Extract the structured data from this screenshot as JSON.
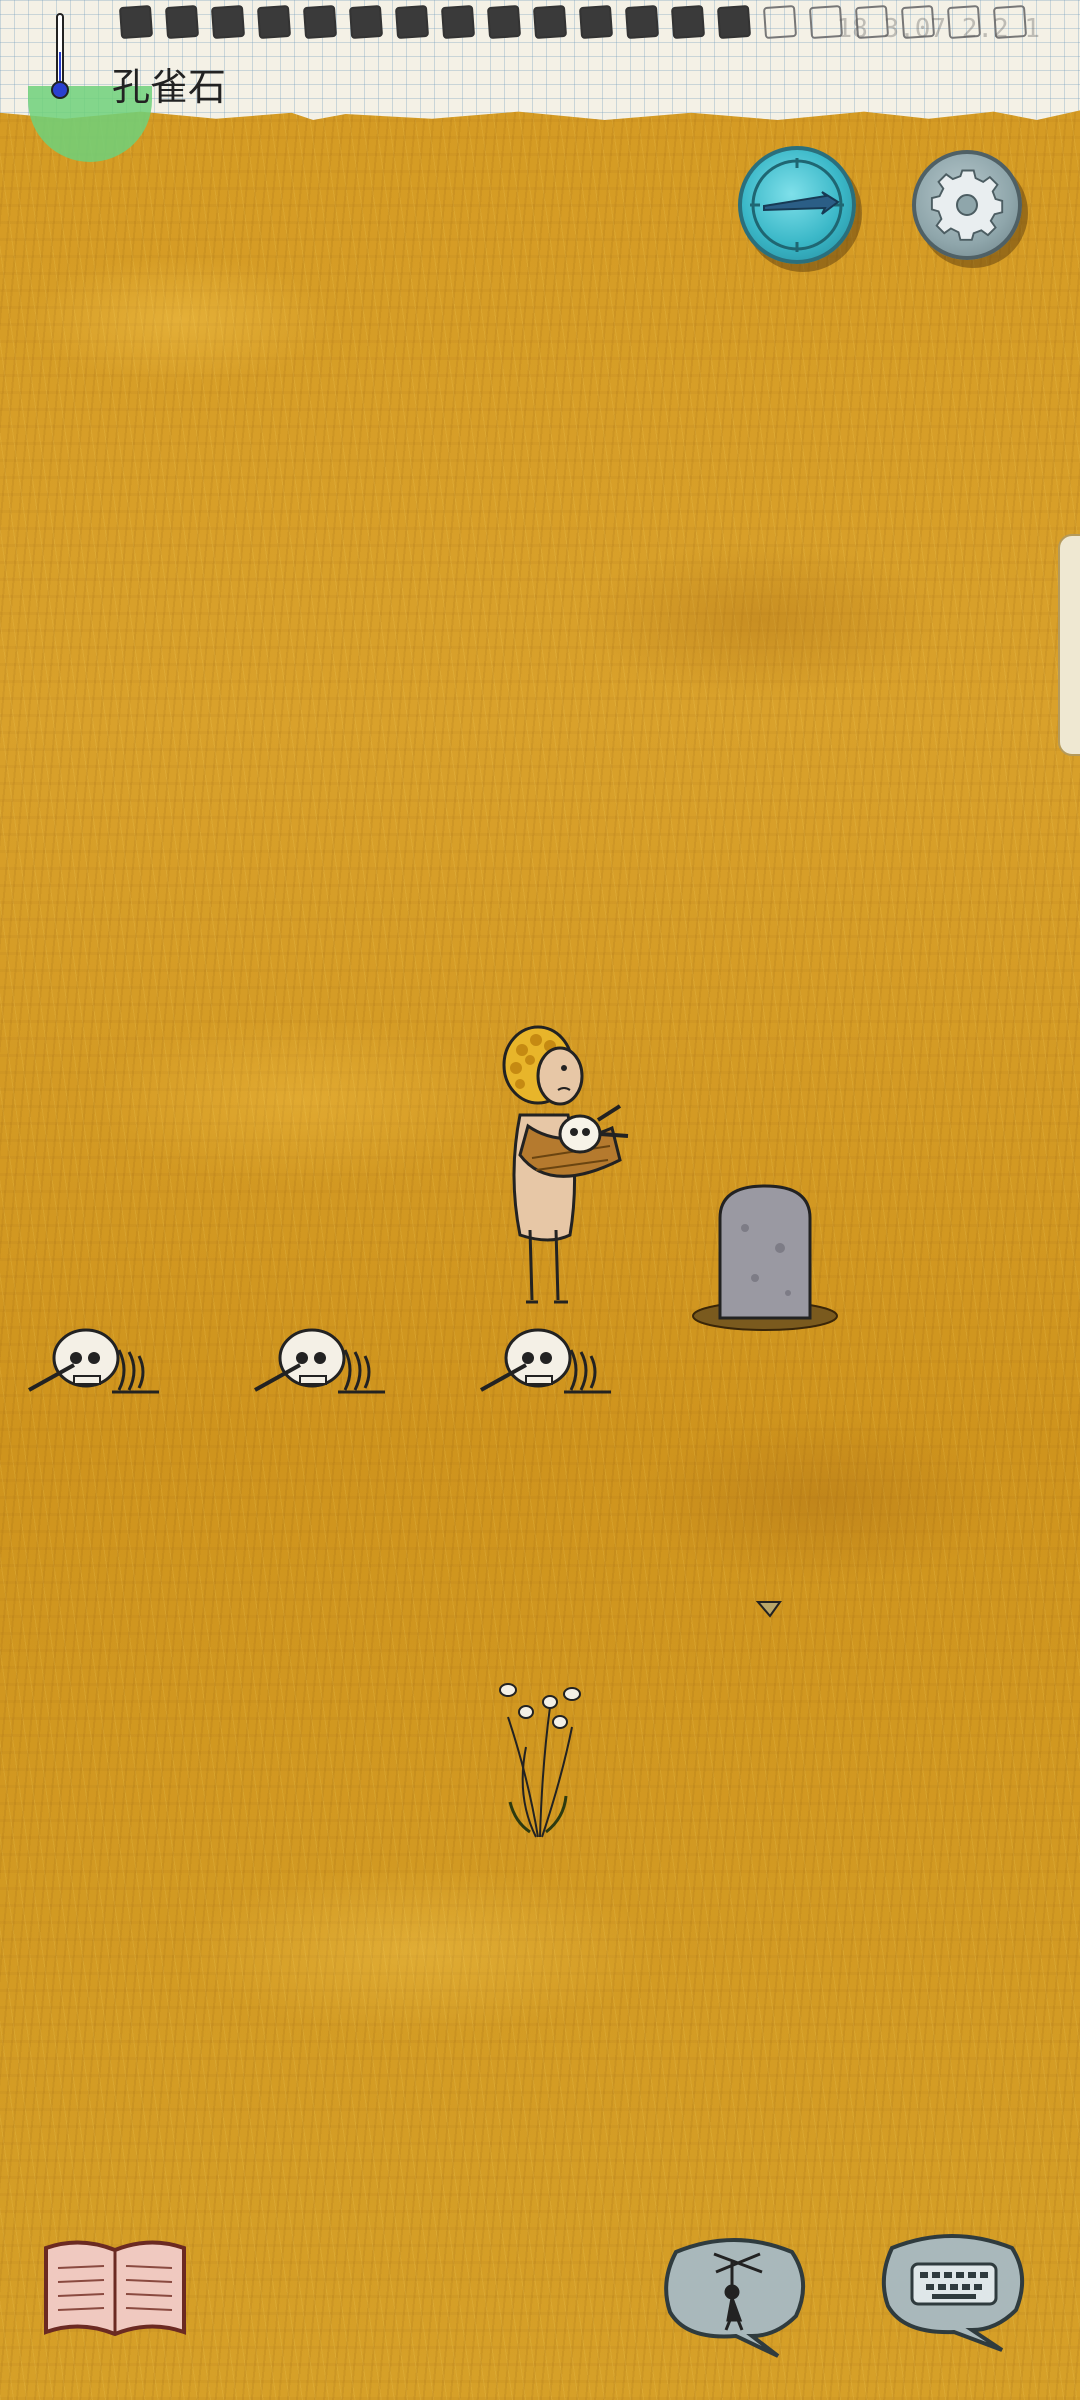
{
  "hud": {
    "location_label": "孔雀石",
    "food_bar": {
      "filled": 14,
      "total": 20
    },
    "age_text": "18 3.07 2.2 1"
  },
  "buttons": {
    "compass": "compass-icon",
    "settings": "gear-icon",
    "emote": "puppet-icon",
    "keyboard": "keyboard-icon",
    "tech_book": "book-icon"
  },
  "world": {
    "objects": [
      "player-character",
      "skeleton-remains",
      "skeleton-remains",
      "skeleton-remains",
      "gravestone",
      "milkweed-plant",
      "small-stone"
    ]
  },
  "colors": {
    "grass": "#d49a22",
    "compass": "#3bb8c8",
    "settings": "#8fa6ab",
    "speech_bubble": "#a9b8bb"
  }
}
